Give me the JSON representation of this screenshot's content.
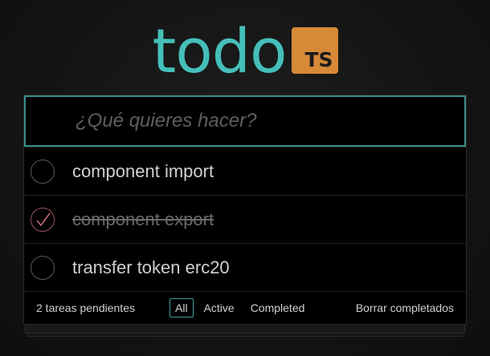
{
  "logo": {
    "text": "todo",
    "badge": "TS"
  },
  "new_todo": {
    "placeholder": "¿Qué quieres hacer?",
    "value": ""
  },
  "todos": [
    {
      "label": "component import",
      "completed": false
    },
    {
      "label": "component export",
      "completed": true
    },
    {
      "label": "transfer token erc20",
      "completed": false
    }
  ],
  "footer": {
    "count_text": "2 tareas pendientes",
    "filters": [
      "All",
      "Active",
      "Completed"
    ],
    "selected_filter": "All",
    "clear_label": "Borrar completados"
  },
  "colors": {
    "accent": "#45bfb9",
    "badge": "#d68a37",
    "check": "#9a5560"
  },
  "icons": {
    "unchecked": "empty-circle-icon",
    "checked": "checkmark-circle-icon"
  }
}
